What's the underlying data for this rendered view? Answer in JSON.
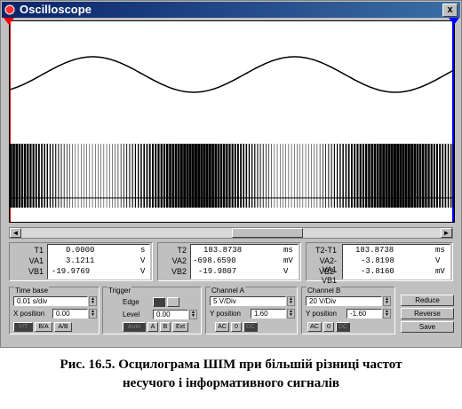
{
  "window": {
    "title": "Oscilloscope",
    "close_label": "x"
  },
  "scroll": {
    "left": "◄",
    "right": "►"
  },
  "meas1": {
    "labels": [
      "T1",
      "VA1",
      "VB1"
    ],
    "values": [
      "0.0000",
      "3.1211",
      "-19.9769"
    ],
    "units": [
      "s",
      "V",
      "V"
    ]
  },
  "meas2": {
    "labels": [
      "T2",
      "VA2",
      "VB2"
    ],
    "values": [
      "183.8738",
      "-698.6590",
      "-19.9807"
    ],
    "units": [
      "ms",
      "mV",
      "V"
    ]
  },
  "meas3": {
    "labels": [
      "T2-T1",
      "VA2-VA1",
      "VB2-VB1"
    ],
    "values": [
      "183.8738",
      "-3.8198",
      "-3.8160"
    ],
    "units": [
      "ms",
      "V",
      "mV"
    ]
  },
  "timebase": {
    "title": "Time base",
    "value": "0.01 s/div",
    "xpos_label": "X position",
    "xpos": "0.00",
    "modes": [
      "Y/T",
      "B/A",
      "A/B"
    ]
  },
  "trigger": {
    "title": "Trigger",
    "edge_label": "Edge",
    "level_label": "Level",
    "level": "0.00",
    "sources": [
      "Auto",
      "A",
      "B",
      "Ext"
    ]
  },
  "channel_a": {
    "title": "Channel A",
    "value": "5 V/Div",
    "ypos_label": "Y position",
    "ypos": "1.60",
    "coupling": [
      "AC",
      "0",
      "DC"
    ]
  },
  "channel_b": {
    "title": "Channel B",
    "value": "20 V/Div",
    "ypos_label": "Y position",
    "ypos": "-1.60",
    "coupling": [
      "AC",
      "0",
      "DC"
    ]
  },
  "buttons": {
    "reduce": "Reduce",
    "reverse": "Reverse",
    "save": "Save"
  },
  "caption": {
    "line1": "Рис. 16.5. Осцилограма ШІМ при більшій різниці частот",
    "line2": "несучого і інформативного сигналів"
  },
  "colors": {
    "titlebar": "#0a246a",
    "cursor1": "#ff0000",
    "cursor2": "#0000ff",
    "trace": "#000000"
  }
}
